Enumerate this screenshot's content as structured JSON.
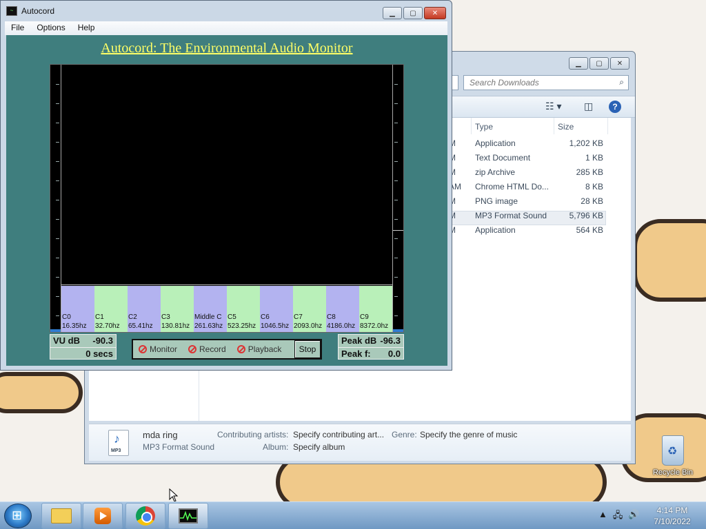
{
  "autocord": {
    "title": "Autocord",
    "menu": [
      "File",
      "Options",
      "Help"
    ],
    "heading": "Autocord: The Environmental Audio Monitor",
    "notes": [
      {
        "name": "C0",
        "freq": "16.35hz"
      },
      {
        "name": "C1",
        "freq": "32.70hz"
      },
      {
        "name": "C2",
        "freq": "65.41hz"
      },
      {
        "name": "C3",
        "freq": "130.81hz"
      },
      {
        "name": "Middle C",
        "freq": "261.63hz"
      },
      {
        "name": "C5",
        "freq": "523.25hz"
      },
      {
        "name": "C6",
        "freq": "1046.5hz"
      },
      {
        "name": "C7",
        "freq": "2093.0hz"
      },
      {
        "name": "C8",
        "freq": "4186.0hz"
      },
      {
        "name": "C9",
        "freq": "8372.0hz"
      }
    ],
    "vu_label": "VU dB",
    "vu_value": "-90.3",
    "secs": "0 secs",
    "peak_db_label": "Peak dB",
    "peak_db_value": "-96.3",
    "peak_f_label": "Peak f:",
    "peak_f_value": "0.0",
    "buttons": {
      "monitor": "Monitor",
      "record": "Record",
      "playback": "Playback",
      "stop": "Stop"
    },
    "colors": {
      "panel": "#3f7e7e",
      "heading": "#ffff66",
      "key_a": "#b3b3f0",
      "key_b": "#b9f0b9"
    }
  },
  "explorer": {
    "search_placeholder": "Search Downloads",
    "columns": {
      "type": "Type",
      "size": "Size"
    },
    "files": [
      {
        "lead": "M",
        "type": "Application",
        "size": "1,202 KB"
      },
      {
        "lead": "M",
        "type": "Text Document",
        "size": "1 KB"
      },
      {
        "lead": "M",
        "type": "zip Archive",
        "size": "285 KB"
      },
      {
        "lead": "AM",
        "type": "Chrome HTML Do...",
        "size": "8 KB"
      },
      {
        "lead": "M",
        "type": "PNG image",
        "size": "28 KB"
      },
      {
        "lead": "M",
        "type": "MP3 Format Sound",
        "size": "5,796 KB"
      },
      {
        "lead": "M",
        "type": "Application",
        "size": "564 KB"
      }
    ],
    "selected_index": 5,
    "details": {
      "name": "mda ring",
      "kind": "MP3 Format Sound",
      "artists_label": "Contributing artists:",
      "artists_value": "Specify contributing art...",
      "genre_label": "Genre:",
      "genre_value": "Specify the genre of music",
      "album_label": "Album:",
      "album_value": "Specify album"
    }
  },
  "desktop": {
    "recycle_bin": "Recycle Bin"
  },
  "taskbar": {
    "time": "4:14 PM",
    "date": "7/10/2022"
  }
}
